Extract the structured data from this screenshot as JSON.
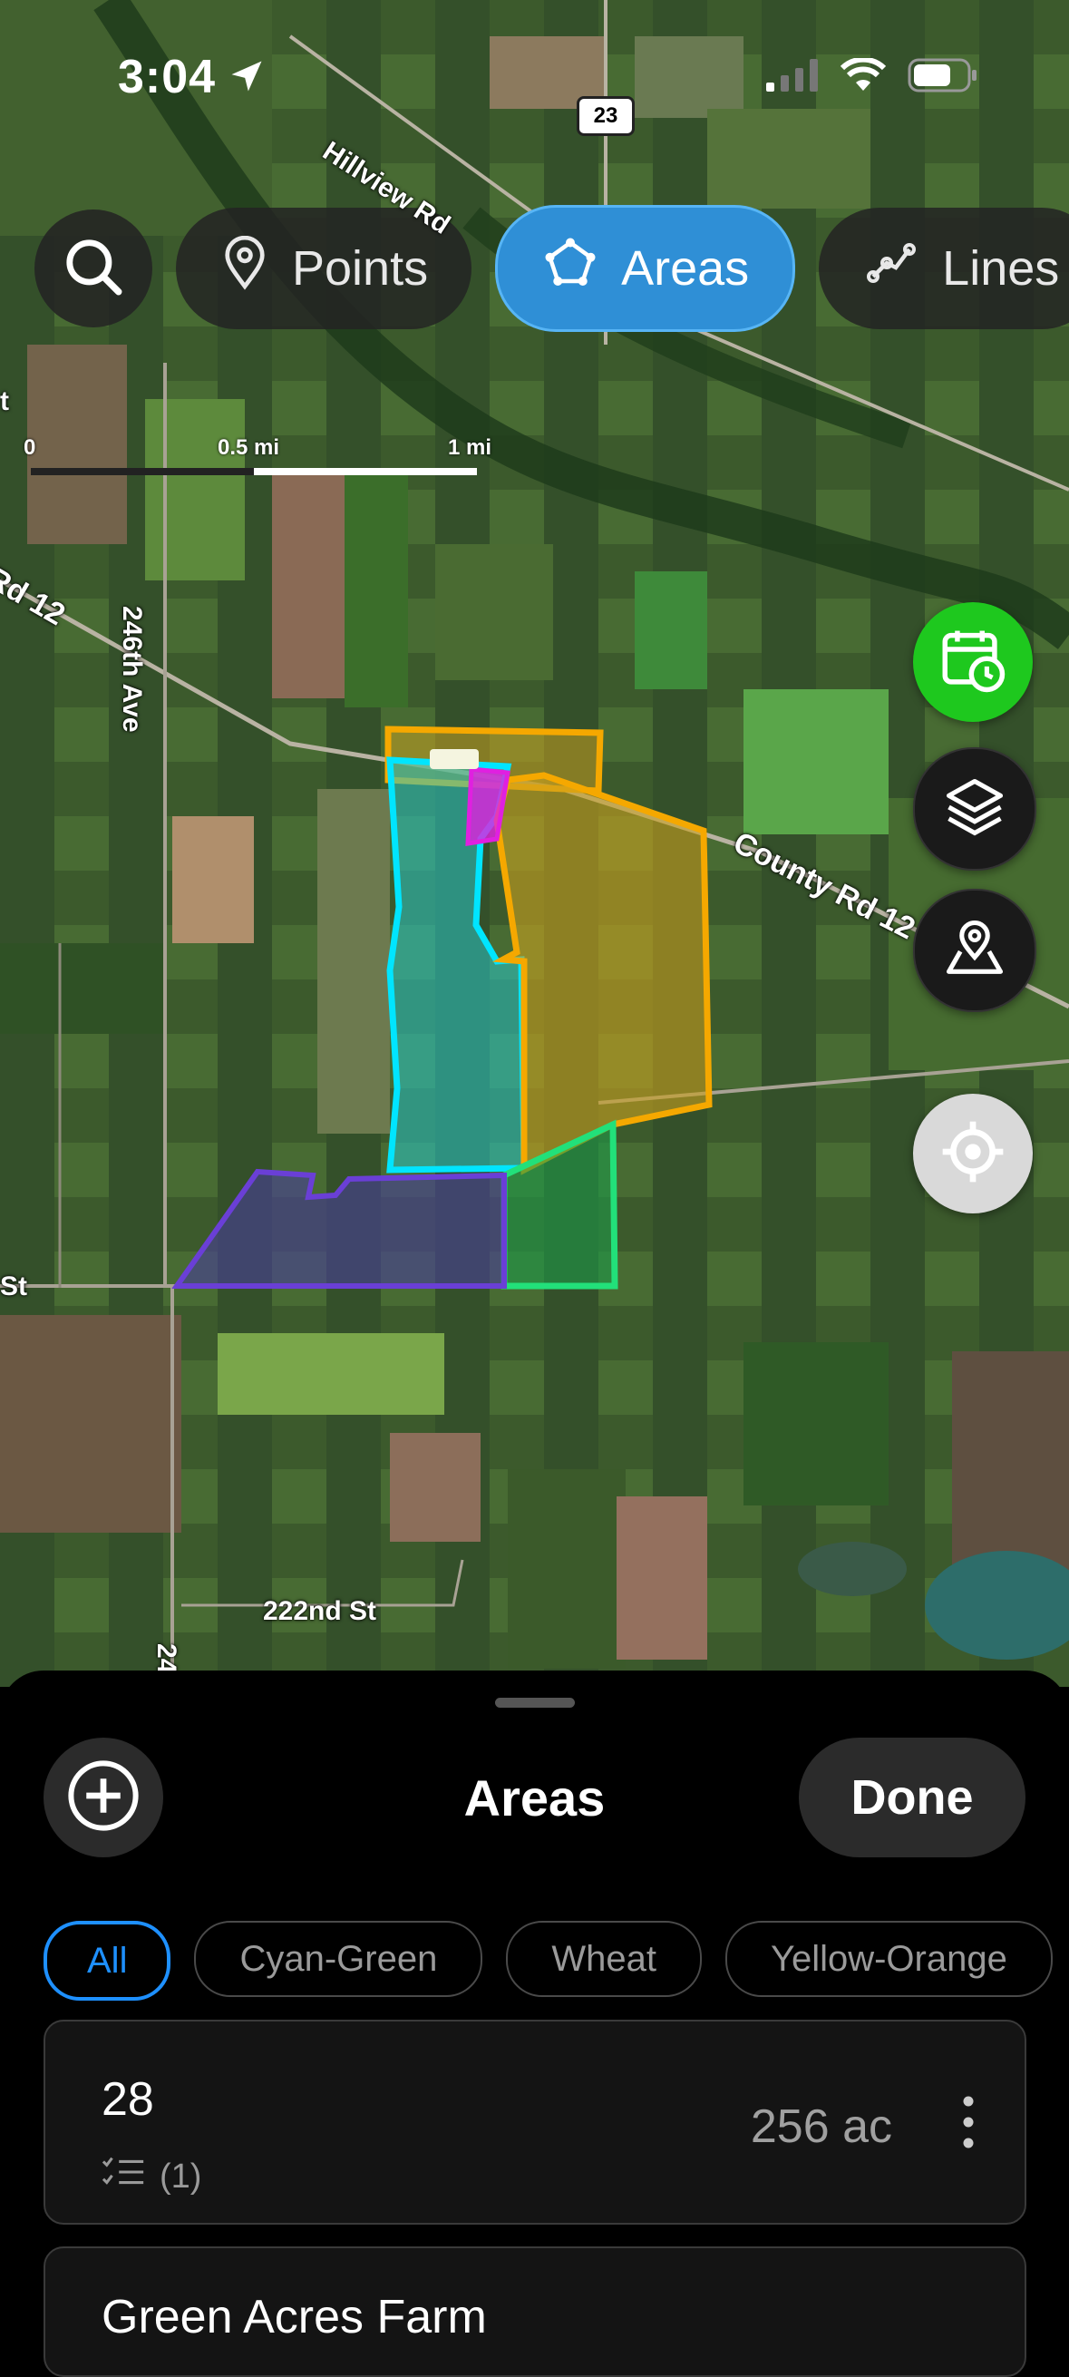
{
  "status_bar": {
    "time": "3:04"
  },
  "toolbar": {
    "search_icon": "search-icon",
    "tabs": [
      {
        "label": "Points",
        "icon": "pin-icon",
        "active": false
      },
      {
        "label": "Areas",
        "icon": "polygon-icon",
        "active": true
      },
      {
        "label": "Lines",
        "icon": "line-icon",
        "active": false
      }
    ]
  },
  "scale": {
    "ticks": [
      "0",
      "0.5 mi",
      "1 mi"
    ]
  },
  "map_labels": {
    "road1": "Hillview Rd",
    "road2": "23",
    "road3": "246th Ave",
    "road4": "Rd 12",
    "road5": "County Rd 12",
    "road6": "222nd St",
    "edge_t": "t",
    "edge_st": "St",
    "edge_24": "24"
  },
  "map_buttons": {
    "calendar": "calendar-clock-icon",
    "layers": "layers-icon",
    "map_pin": "map-pin-icon",
    "locate": "locate-icon"
  },
  "colors": {
    "accent": "#1e90ff",
    "calendar_button": "#1ec81e",
    "area_cyan": "#00e5ff",
    "area_yellow": "#f5a800",
    "area_green": "#22e07a",
    "area_purple": "#6a3fd6",
    "area_magenta": "#e020e0"
  },
  "sheet": {
    "title": "Areas",
    "done_label": "Done",
    "filters": [
      "All",
      "Cyan-Green",
      "Wheat",
      "Yellow-Orange"
    ],
    "items": [
      {
        "name": "28",
        "tasks": "(1)",
        "size": "256 ac"
      },
      {
        "name": "Green Acres Farm"
      }
    ]
  }
}
